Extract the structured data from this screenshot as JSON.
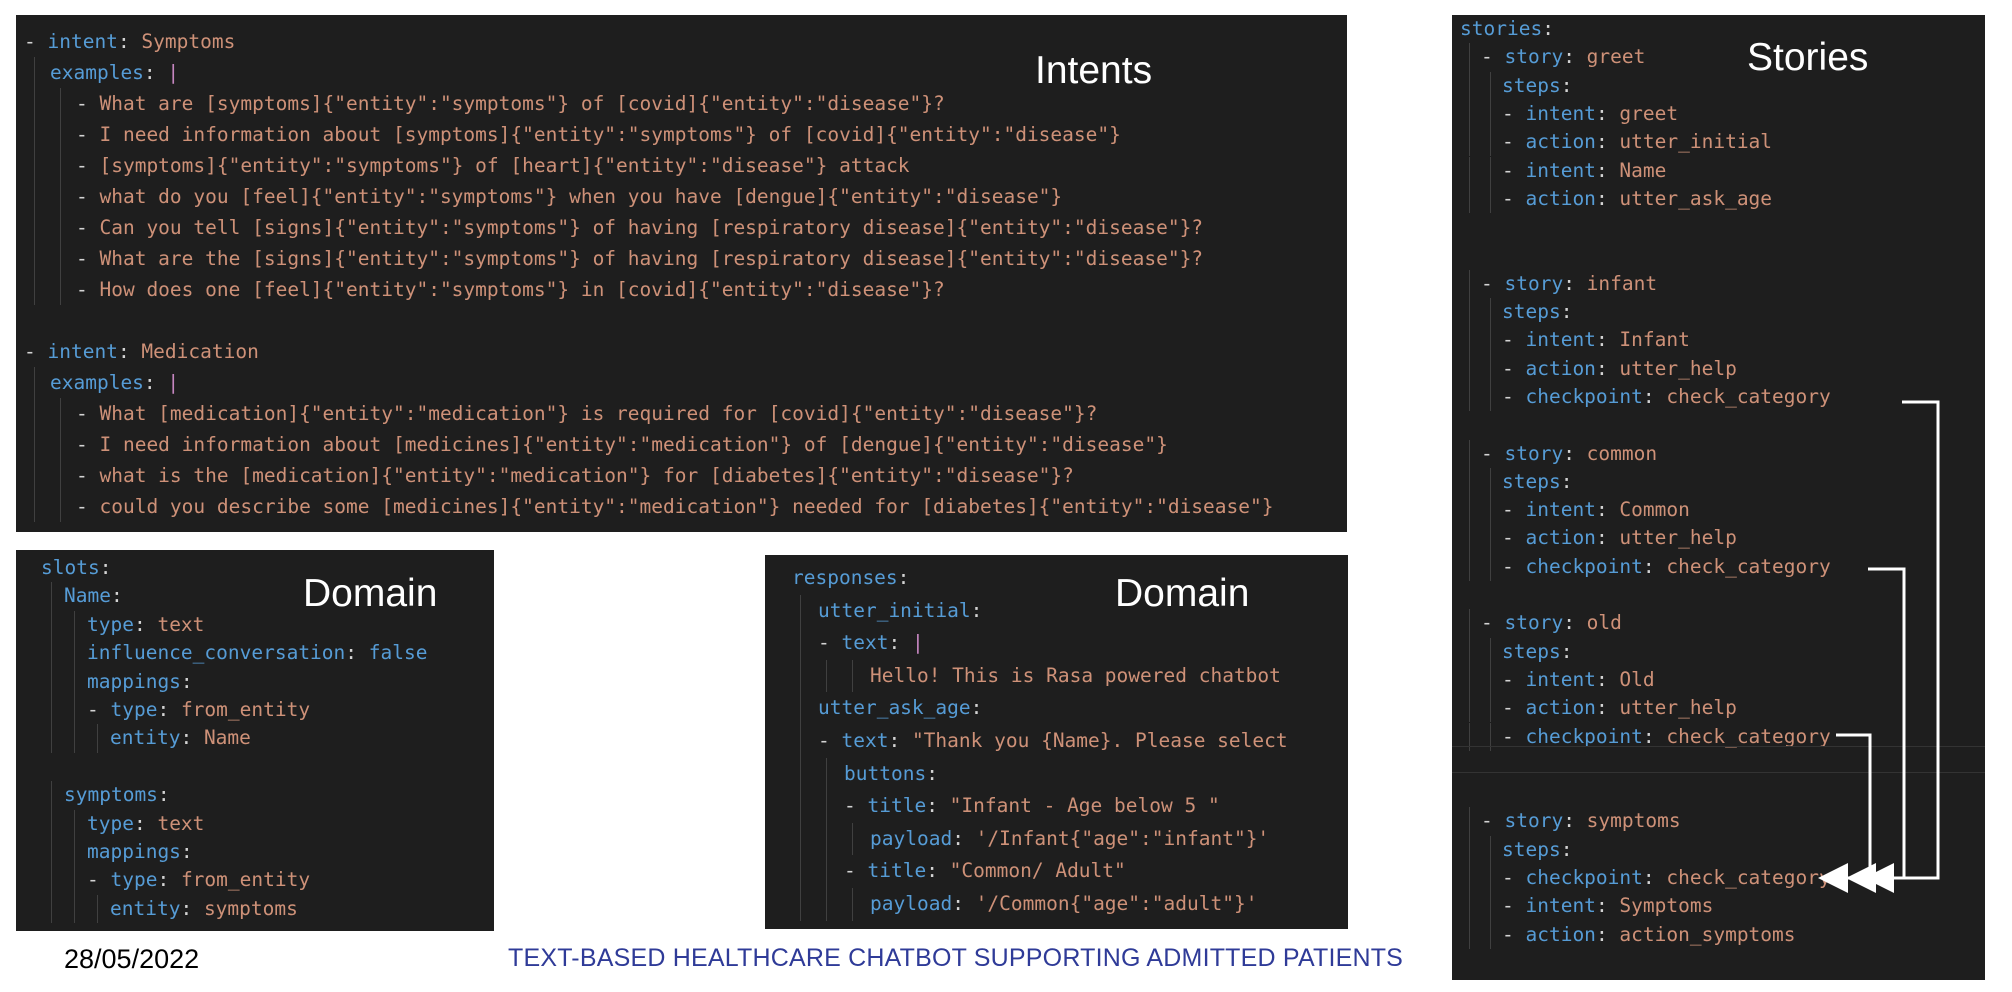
{
  "intents_panel": {
    "label": "Intents",
    "lines": [
      {
        "dash": "- ",
        "key": "intent",
        "val": "Symptoms"
      },
      {
        "indent": 1,
        "key": "examples",
        "cursor": "|"
      },
      {
        "indent": 2,
        "dash": "- ",
        "text": "What are [symptoms]{\"entity\":\"symptoms\"} of [covid]{\"entity\":\"disease\"}?"
      },
      {
        "indent": 2,
        "dash": "- ",
        "text": "I need information about [symptoms]{\"entity\":\"symptoms\"} of [covid]{\"entity\":\"disease\"}"
      },
      {
        "indent": 2,
        "dash": "- ",
        "text": "[symptoms]{\"entity\":\"symptoms\"} of [heart]{\"entity\":\"disease\"} attack"
      },
      {
        "indent": 2,
        "dash": "- ",
        "text": "what do you [feel]{\"entity\":\"symptoms\"} when you have [dengue]{\"entity\":\"disease\"}"
      },
      {
        "indent": 2,
        "dash": "- ",
        "text": "Can you tell [signs]{\"entity\":\"symptoms\"} of having [respiratory disease]{\"entity\":\"disease\"}?"
      },
      {
        "indent": 2,
        "dash": "- ",
        "text": "What are the [signs]{\"entity\":\"symptoms\"} of having [respiratory disease]{\"entity\":\"disease\"}?"
      },
      {
        "indent": 2,
        "dash": "- ",
        "text": "How does one [feel]{\"entity\":\"symptoms\"} in [covid]{\"entity\":\"disease\"}?"
      },
      {
        "blank": true
      },
      {
        "dash": "- ",
        "key": "intent",
        "val": "Medication"
      },
      {
        "indent": 1,
        "key": "examples",
        "cursor": "|"
      },
      {
        "indent": 2,
        "dash": "- ",
        "text": "What [medication]{\"entity\":\"medication\"} is required for [covid]{\"entity\":\"disease\"}?"
      },
      {
        "indent": 2,
        "dash": "- ",
        "text": "I need information about [medicines]{\"entity\":\"medication\"} of [dengue]{\"entity\":\"disease\"}"
      },
      {
        "indent": 2,
        "dash": "- ",
        "text": "what is the [medication]{\"entity\":\"medication\"} for [diabetes]{\"entity\":\"disease\"}?"
      },
      {
        "indent": 2,
        "dash": "- ",
        "text": "could you describe some [medicines]{\"entity\":\"medication\"} needed for [diabetes]{\"entity\":\"disease\"}"
      }
    ]
  },
  "slots_panel": {
    "label": "Domain",
    "lines": [
      {
        "indent": 0,
        "key": "slots"
      },
      {
        "indent": 1,
        "key": "Name"
      },
      {
        "indent": 2,
        "key": "type",
        "val": "text"
      },
      {
        "indent": 2,
        "key": "influence_conversation",
        "val": "false",
        "bool": true
      },
      {
        "indent": 2,
        "key": "mappings"
      },
      {
        "indent": 2,
        "dash": "- ",
        "key": "type",
        "val": "from_entity"
      },
      {
        "indent": 3,
        "key": "entity",
        "val": "Name"
      },
      {
        "blank": true
      },
      {
        "indent": 1,
        "key": "symptoms"
      },
      {
        "indent": 2,
        "key": "type",
        "val": "text"
      },
      {
        "indent": 2,
        "key": "mappings"
      },
      {
        "indent": 2,
        "dash": "- ",
        "key": "type",
        "val": "from_entity"
      },
      {
        "indent": 3,
        "key": "entity",
        "val": "symptoms"
      }
    ]
  },
  "responses_panel": {
    "label": "Domain",
    "lines": [
      {
        "indent": 0,
        "key": "responses"
      },
      {
        "indent": 1,
        "key": "utter_initial"
      },
      {
        "indent": 1,
        "dash": "- ",
        "key": "text",
        "cursor": "|"
      },
      {
        "indent": 3,
        "text": "Hello! This is Rasa powered chatbot"
      },
      {
        "indent": 1,
        "key": "utter_ask_age"
      },
      {
        "indent": 1,
        "dash": "- ",
        "key": "text",
        "val": "\"Thank you {Name}. Please select"
      },
      {
        "indent": 2,
        "key": "buttons"
      },
      {
        "indent": 2,
        "dash": "- ",
        "key": "title",
        "val": "\"Infant - Age below 5 \""
      },
      {
        "indent": 3,
        "key": "payload",
        "val": "'/Infant{\"age\":\"infant\"}'"
      },
      {
        "indent": 2,
        "dash": "- ",
        "key": "title",
        "val": "\"Common/ Adult\""
      },
      {
        "indent": 3,
        "key": "payload",
        "val": "'/Common{\"age\":\"adult\"}'"
      }
    ]
  },
  "stories_panel": {
    "label": "Stories",
    "lines": [
      {
        "indent": 0,
        "key": "stories"
      },
      {
        "indent": 1,
        "dash": "- ",
        "key": "story",
        "val": "greet"
      },
      {
        "indent": 2,
        "key": "steps"
      },
      {
        "indent": 2,
        "dash": "- ",
        "key": "intent",
        "val": "greet"
      },
      {
        "indent": 2,
        "dash": "- ",
        "key": "action",
        "val": "utter_initial"
      },
      {
        "indent": 2,
        "dash": "- ",
        "key": "intent",
        "val": "Name"
      },
      {
        "indent": 2,
        "dash": "- ",
        "key": "action",
        "val": "utter_ask_age"
      },
      {
        "blank": true
      },
      {
        "blank": true
      },
      {
        "indent": 1,
        "dash": "- ",
        "key": "story",
        "val": "infant"
      },
      {
        "indent": 2,
        "key": "steps"
      },
      {
        "indent": 2,
        "dash": "- ",
        "key": "intent",
        "val": "Infant"
      },
      {
        "indent": 2,
        "dash": "- ",
        "key": "action",
        "val": "utter_help"
      },
      {
        "indent": 2,
        "dash": "- ",
        "key": "checkpoint",
        "val": "check_category"
      },
      {
        "blank": true
      },
      {
        "indent": 1,
        "dash": "- ",
        "key": "story",
        "val": "common"
      },
      {
        "indent": 2,
        "key": "steps"
      },
      {
        "indent": 2,
        "dash": "- ",
        "key": "intent",
        "val": "Common"
      },
      {
        "indent": 2,
        "dash": "- ",
        "key": "action",
        "val": "utter_help"
      },
      {
        "indent": 2,
        "dash": "- ",
        "key": "checkpoint",
        "val": "check_category"
      },
      {
        "blank": true
      },
      {
        "indent": 1,
        "dash": "- ",
        "key": "story",
        "val": "old"
      },
      {
        "indent": 2,
        "key": "steps"
      },
      {
        "indent": 2,
        "dash": "- ",
        "key": "intent",
        "val": "Old"
      },
      {
        "indent": 2,
        "dash": "- ",
        "key": "action",
        "val": "utter_help"
      },
      {
        "indent": 2,
        "dash": "- ",
        "key": "checkpoint",
        "val": "check_category"
      },
      {
        "blank": true
      },
      {
        "blank": true
      },
      {
        "indent": 1,
        "dash": "- ",
        "key": "story",
        "val": "symptoms"
      },
      {
        "indent": 2,
        "key": "steps"
      },
      {
        "indent": 2,
        "dash": "- ",
        "key": "checkpoint",
        "val": "check_category"
      },
      {
        "indent": 2,
        "dash": "- ",
        "key": "intent",
        "val": "Symptoms"
      },
      {
        "indent": 2,
        "dash": "- ",
        "key": "action",
        "val": "action_symptoms"
      }
    ]
  },
  "footer": {
    "date": "28/05/2022",
    "title": "TEXT-BASED HEALTHCARE CHATBOT SUPPORTING ADMITTED PATIENTS"
  },
  "colors": {
    "panel_bg": "#1e1e1e",
    "key": "#569cd6",
    "string": "#ce9178",
    "punct": "#d4d4d4",
    "footer_title": "#2f3b98"
  },
  "icons": [
    "checkpoint-arrow"
  ]
}
